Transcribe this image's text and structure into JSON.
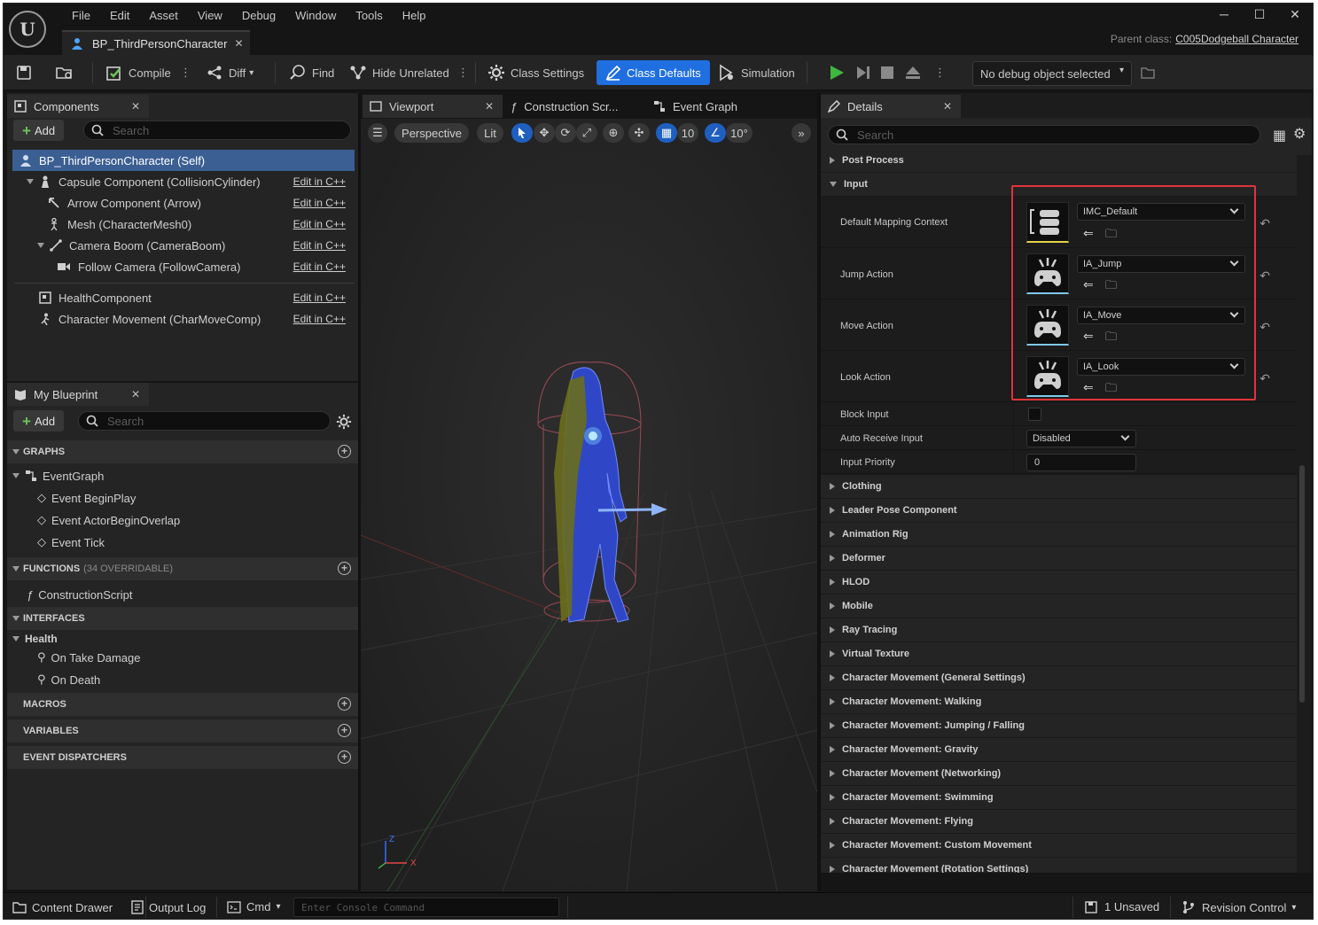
{
  "window": {
    "menu": [
      "File",
      "Edit",
      "Asset",
      "View",
      "Debug",
      "Window",
      "Tools",
      "Help"
    ],
    "document_tab": "BP_ThirdPersonCharacter",
    "parent_class_label": "Parent class:",
    "parent_class_value": "C005Dodgeball Character",
    "logo_text": "U"
  },
  "toolbar": {
    "compile": "Compile",
    "diff": "Diff",
    "find": "Find",
    "hide_unrelated": "Hide Unrelated",
    "class_settings": "Class Settings",
    "class_defaults": "Class Defaults",
    "simulation": "Simulation",
    "debug_object": "No debug object selected"
  },
  "components": {
    "tab": "Components",
    "add": "Add",
    "search_placeholder": "Search",
    "edit_label": "Edit in C++",
    "items": [
      {
        "label": "BP_ThirdPersonCharacter (Self)"
      },
      {
        "label": "Capsule Component (CollisionCylinder)"
      },
      {
        "label": "Arrow Component (Arrow)"
      },
      {
        "label": "Mesh (CharacterMesh0)"
      },
      {
        "label": "Camera Boom (CameraBoom)"
      },
      {
        "label": "Follow Camera (FollowCamera)"
      },
      {
        "label": "HealthComponent"
      },
      {
        "label": "Character Movement (CharMoveComp)"
      }
    ]
  },
  "my_blueprint": {
    "tab": "My Blueprint",
    "add": "Add",
    "search_placeholder": "Search",
    "graphs": "GRAPHS",
    "event_graph": "EventGraph",
    "events": [
      "Event BeginPlay",
      "Event ActorBeginOverlap",
      "Event Tick"
    ],
    "functions": "FUNCTIONS",
    "functions_count": "(34 OVERRIDABLE)",
    "construction_script": "ConstructionScript",
    "interfaces": "INTERFACES",
    "health": "Health",
    "health_items": [
      "On Take Damage",
      "On Death"
    ],
    "macros": "MACROS",
    "variables": "VARIABLES",
    "event_dispatchers": "EVENT DISPATCHERS"
  },
  "viewport": {
    "tabs": [
      "Viewport",
      "Construction Scr...",
      "Event Graph"
    ],
    "perspective": "Perspective",
    "lit": "Lit",
    "grid_snap": "10",
    "rot_snap": "10°",
    "axis_x": "X",
    "axis_z": "Z"
  },
  "details": {
    "tab": "Details",
    "search_placeholder": "Search",
    "post_process": "Post Process",
    "input": "Input",
    "input_props": [
      {
        "label": "Default Mapping Context",
        "value": "IMC_Default"
      },
      {
        "label": "Jump Action",
        "value": "IA_Jump"
      },
      {
        "label": "Move Action",
        "value": "IA_Move"
      },
      {
        "label": "Look Action",
        "value": "IA_Look"
      }
    ],
    "block_input": "Block Input",
    "auto_receive_input": "Auto Receive Input",
    "auto_receive_value": "Disabled",
    "input_priority": "Input Priority",
    "input_priority_value": "0",
    "categories": [
      "Clothing",
      "Leader Pose Component",
      "Animation Rig",
      "Deformer",
      "HLOD",
      "Mobile",
      "Ray Tracing",
      "Virtual Texture",
      "Character Movement (General Settings)",
      "Character Movement: Walking",
      "Character Movement: Jumping / Falling",
      "Character Movement: Gravity",
      "Character Movement (Networking)",
      "Character Movement: Swimming",
      "Character Movement: Flying",
      "Character Movement: Custom Movement",
      "Character Movement (Rotation Settings)"
    ]
  },
  "statusbar": {
    "content_drawer": "Content Drawer",
    "output_log": "Output Log",
    "cmd": "Cmd",
    "console_placeholder": "Enter Console Command",
    "unsaved": "1 Unsaved",
    "revision_control": "Revision Control"
  },
  "colors": {
    "accent": "#1f6fe0",
    "highlight_box": "#e0343a",
    "play": "#3fb83f"
  }
}
